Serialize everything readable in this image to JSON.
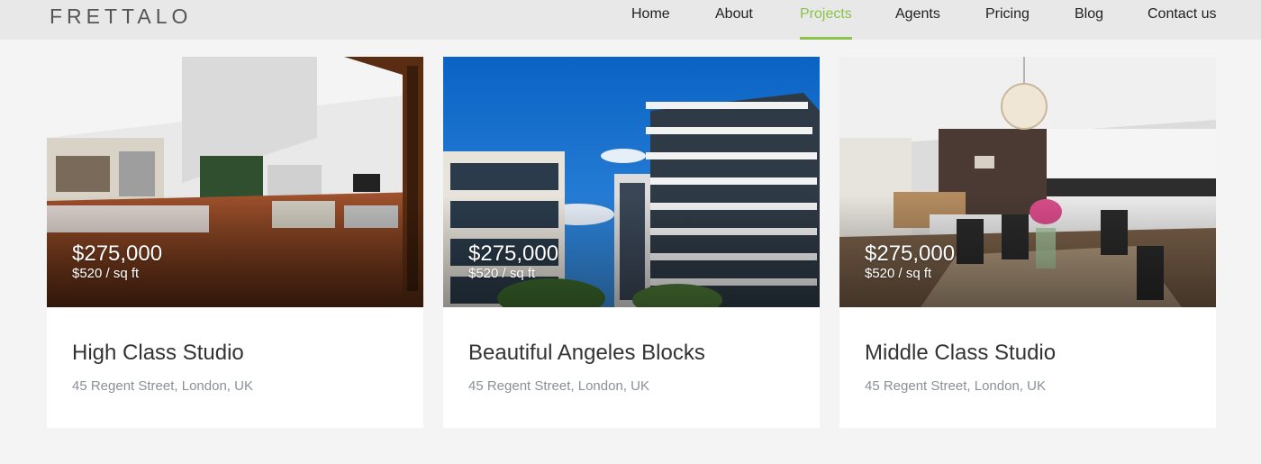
{
  "brand": {
    "logo": "FRETTALO",
    "accent_color": "#8bc34a"
  },
  "nav": {
    "items": [
      {
        "label": "Home",
        "active": false
      },
      {
        "label": "About",
        "active": false
      },
      {
        "label": "Projects",
        "active": true
      },
      {
        "label": "Agents",
        "active": false
      },
      {
        "label": "Pricing",
        "active": false
      },
      {
        "label": "Blog",
        "active": false
      },
      {
        "label": "Contact us",
        "active": false
      }
    ]
  },
  "listings": [
    {
      "image": "interior-living-room-photo",
      "price": "$275,000",
      "price_per_sqft": "$520 / sq ft",
      "title": "High Class Studio",
      "address": "45 Regent Street, London, UK"
    },
    {
      "image": "apartment-buildings-photo",
      "price": "$275,000",
      "price_per_sqft": "$520 / sq ft",
      "title": "Beautiful Angeles Blocks",
      "address": "45 Regent Street, London, UK"
    },
    {
      "image": "dining-kitchen-photo",
      "price": "$275,000",
      "price_per_sqft": "$520 / sq ft",
      "title": "Middle Class Studio",
      "address": "45 Regent Street, London, UK"
    }
  ]
}
